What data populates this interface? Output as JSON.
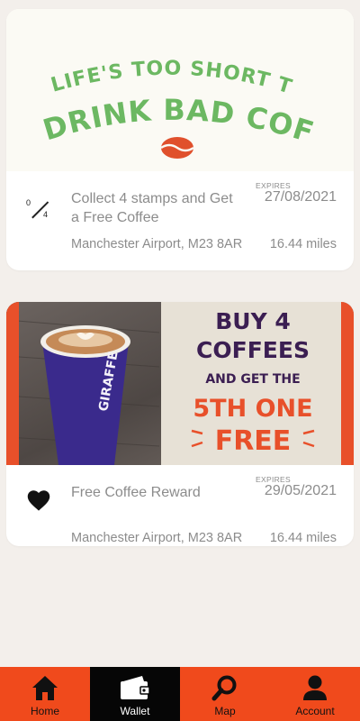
{
  "offers": [
    {
      "banner": {
        "line1": "LIFE'S TOO SHORT TO",
        "line2": "DRINK BAD COFFEE"
      },
      "stamps": {
        "current": "0",
        "total": "4"
      },
      "title": "Collect 4 stamps and Get a Free Coffee",
      "expires_label": "EXPIRES",
      "expires_date": "27/08/2021",
      "location": "Manchester Airport, M23 8AR",
      "distance": "16.44 miles"
    },
    {
      "banner": {
        "line1": "BUY 4",
        "line2": "COFFEES",
        "line3": "AND GET THE",
        "line4": "5TH ONE",
        "line5": "FREE",
        "cup_text": "GIRAFFE"
      },
      "title": "Free Coffee Reward",
      "expires_label": "EXPIRES",
      "expires_date": "29/05/2021",
      "location": "Manchester Airport, M23 8AR",
      "distance": "16.44 miles"
    }
  ],
  "nav": {
    "items": [
      {
        "label": "Home",
        "icon": "home-icon"
      },
      {
        "label": "Wallet",
        "icon": "wallet-icon",
        "active": true
      },
      {
        "label": "Map",
        "icon": "search-icon"
      },
      {
        "label": "Account",
        "icon": "account-icon"
      }
    ]
  },
  "colors": {
    "background": "#f3efeb",
    "nav_bg": "#f04a1c",
    "nav_active": "#060606",
    "banner_green": "#6cb862",
    "banner_purple": "#3b1e52",
    "banner_orange": "#e8502a"
  }
}
